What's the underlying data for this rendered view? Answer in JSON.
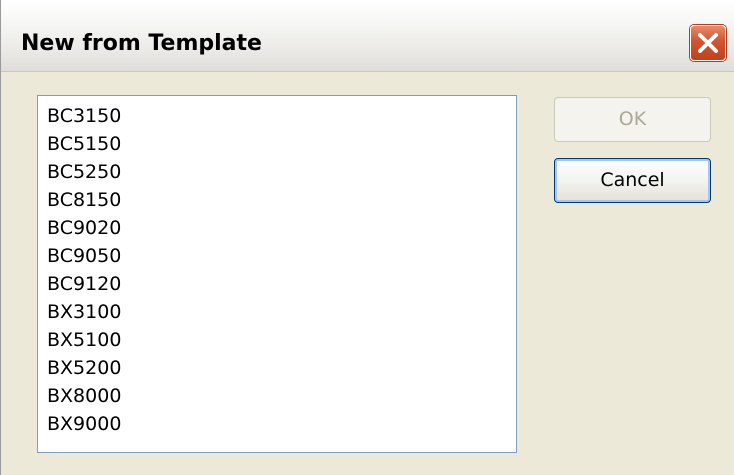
{
  "window": {
    "title": "New from Template",
    "close_icon": "close-x-icon",
    "close_color": "#d1532f"
  },
  "templates": {
    "items": [
      "BC3150",
      "BC5150",
      "BC5250",
      "BC8150",
      "BC9020",
      "BC9050",
      "BC9120",
      "BX3100",
      "BX5100",
      "BX5200",
      "BX8000",
      "BX9000"
    ]
  },
  "buttons": {
    "ok_label": "OK",
    "ok_enabled": false,
    "cancel_label": "Cancel"
  }
}
